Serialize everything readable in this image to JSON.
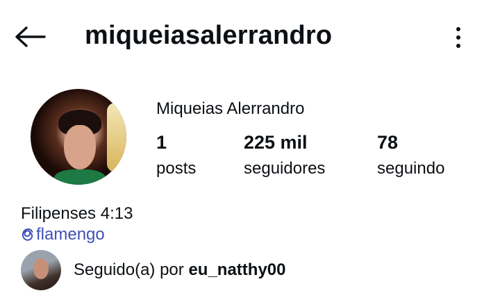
{
  "header": {
    "back_icon": "arrow-left-icon",
    "username": "miqueiasalerrandro",
    "more_icon": "vertical-dots-icon"
  },
  "profile": {
    "full_name": "Miqueias Alerrandro",
    "stats": {
      "posts": {
        "value": "1",
        "label": "posts"
      },
      "followers": {
        "value": "225 mil",
        "label": "seguidores"
      },
      "following": {
        "value": "78",
        "label": "seguindo"
      }
    },
    "bio": "Filipenses 4:13",
    "link": {
      "icon": "threads-icon",
      "text": "flamengo"
    },
    "followed_by": {
      "prefix": "Seguido(a) por ",
      "username": "eu_natthy00"
    }
  },
  "colors": {
    "link": "#3f51b5",
    "text": "#0c1014",
    "background": "#ffffff"
  }
}
